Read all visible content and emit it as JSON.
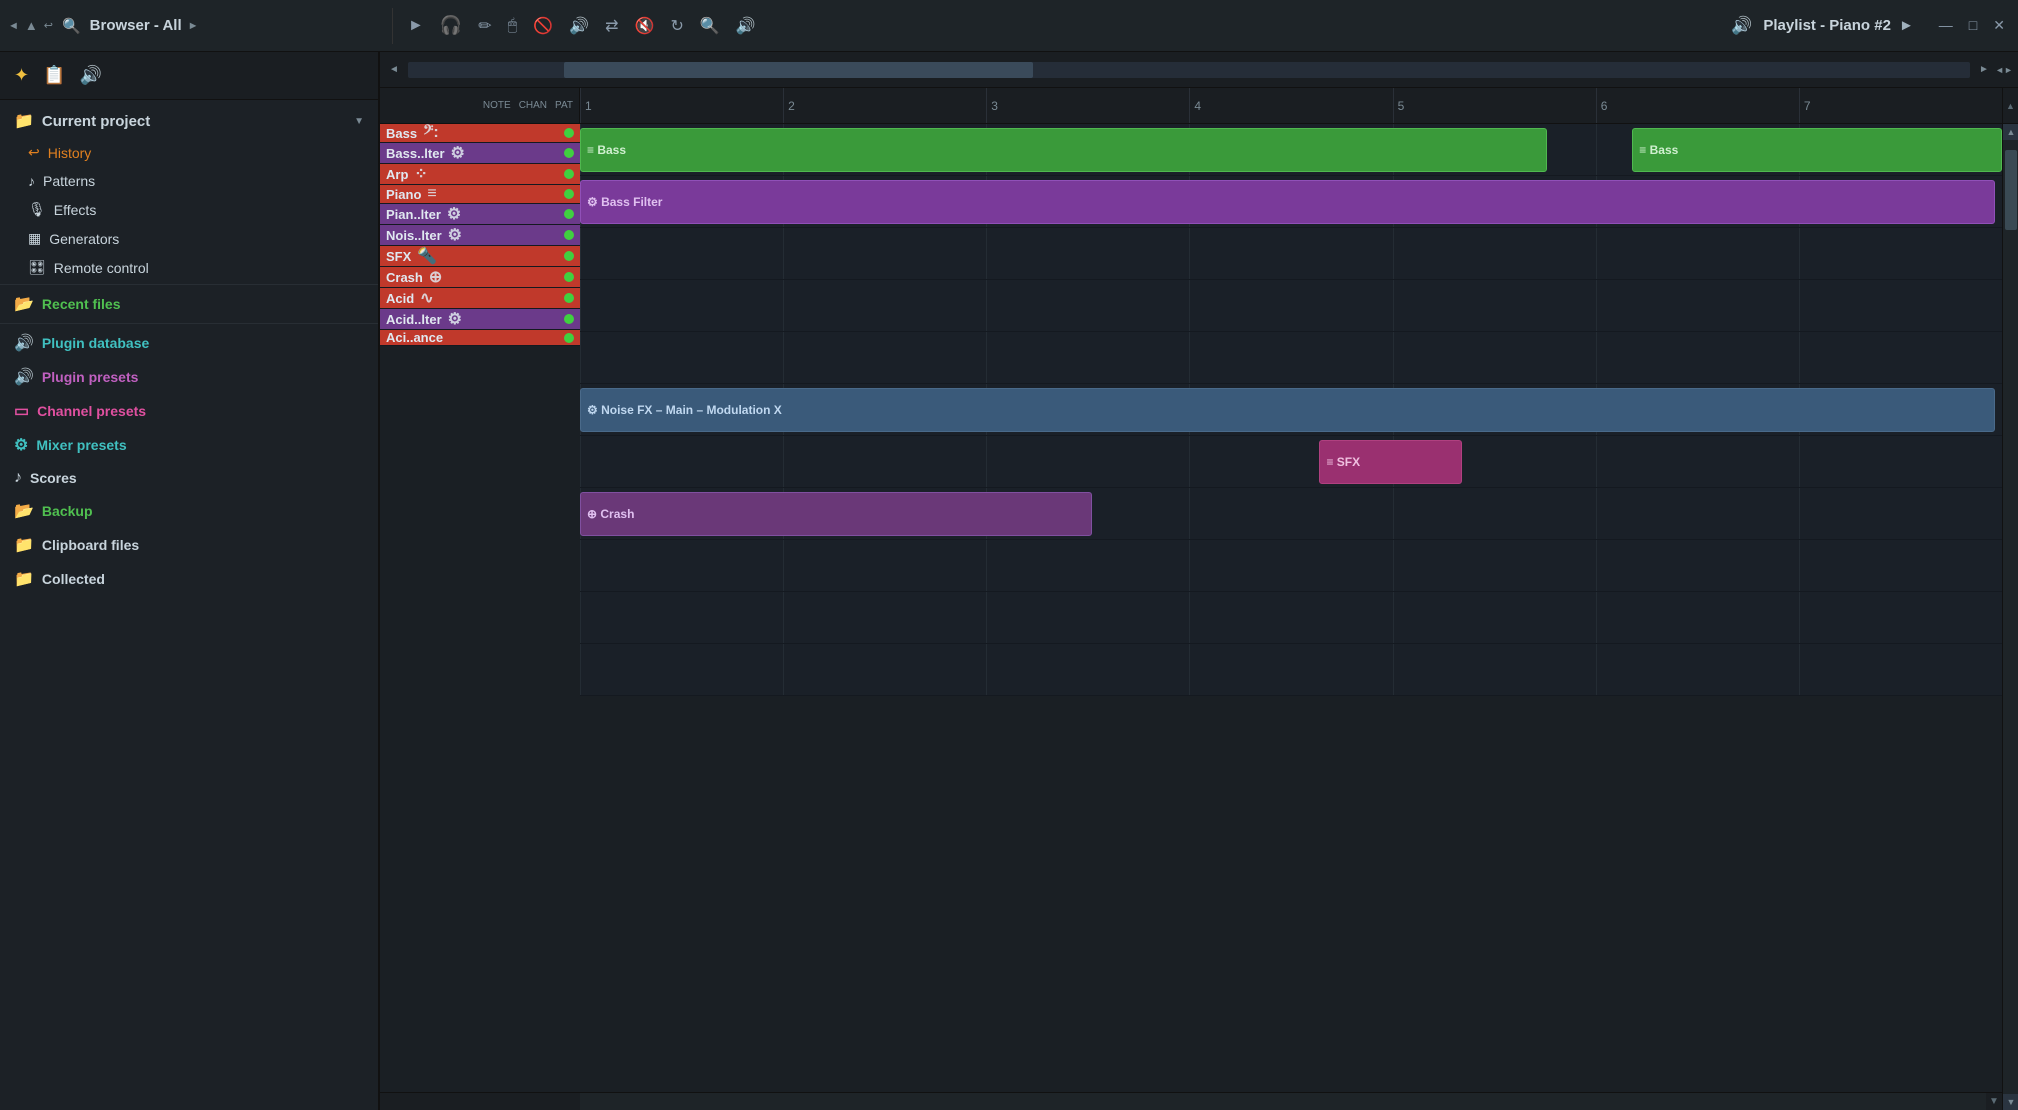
{
  "topbar": {
    "nav_prev": "◄",
    "nav_up": "▲",
    "nav_back": "↩",
    "search_icon": "🔍",
    "browser_title": "Browser - All",
    "nav_next": "►",
    "playlist_title": "Playlist - Piano #2",
    "playlist_arrow": "►",
    "win_min": "—",
    "win_max": "□",
    "win_close": "✕"
  },
  "sidebar": {
    "toolbar": {
      "star_icon": "✦",
      "file_icon": "📋",
      "speaker_icon": "🔊"
    },
    "current_project_label": "Current project",
    "items": [
      {
        "label": "History",
        "icon": "↩",
        "color": "orange"
      },
      {
        "label": "Patterns",
        "icon": "♪",
        "color": "white"
      },
      {
        "label": "Effects",
        "icon": "🎙",
        "color": "white"
      },
      {
        "label": "Generators",
        "icon": "▦",
        "color": "white"
      },
      {
        "label": "Remote control",
        "icon": "🎛",
        "color": "white"
      }
    ],
    "nav_items": [
      {
        "label": "Recent files",
        "icon": "📂",
        "color": "green"
      },
      {
        "label": "Plugin database",
        "icon": "🔊",
        "color": "cyan"
      },
      {
        "label": "Plugin presets",
        "icon": "🔊",
        "color": "purple"
      },
      {
        "label": "Channel presets",
        "icon": "▭",
        "color": "pink"
      },
      {
        "label": "Mixer presets",
        "icon": "⚙",
        "color": "cyan"
      },
      {
        "label": "Scores",
        "icon": "♪",
        "color": "white"
      },
      {
        "label": "Backup",
        "icon": "📂",
        "color": "green"
      },
      {
        "label": "Clipboard files",
        "icon": "📁",
        "color": "white"
      },
      {
        "label": "Collected",
        "icon": "📁",
        "color": "white"
      }
    ]
  },
  "playlist": {
    "ruler": [
      "1",
      "2",
      "3",
      "4",
      "5",
      "6",
      "7"
    ],
    "header_cols": [
      "NOTE",
      "CHAN",
      "PAT"
    ],
    "tracks": [
      {
        "name": "Bass",
        "icon": "𝄢",
        "color_class": "track-bass",
        "clips": [
          {
            "label": "≡ Bass",
            "start_pct": 0,
            "width_pct": 68,
            "color": "clip-green"
          },
          {
            "label": "≡ Bass",
            "start_pct": 74,
            "width_pct": 26,
            "color": "clip-green"
          }
        ]
      },
      {
        "name": "Bass..lter",
        "icon": "⚙",
        "color_class": "track-bass-filter",
        "clips": [
          {
            "label": "⚙ Bass Filter",
            "start_pct": 0,
            "width_pct": 100,
            "color": "clip-purple"
          }
        ]
      },
      {
        "name": "Arp",
        "icon": "⁘",
        "color_class": "track-arp",
        "clips": []
      },
      {
        "name": "Piano",
        "icon": "≡",
        "color_class": "track-piano",
        "clips": []
      },
      {
        "name": "Pian..lter",
        "icon": "⚙",
        "color_class": "track-piano-filter",
        "clips": []
      },
      {
        "name": "Nois..lter",
        "icon": "⚙",
        "color_class": "track-nois-filter",
        "clips": [
          {
            "label": "⚙ Noise FX – Main – Modulation X",
            "start_pct": 0,
            "width_pct": 100,
            "color": "clip-blue"
          }
        ]
      },
      {
        "name": "SFX",
        "icon": "🔦",
        "color_class": "track-sfx",
        "clips": [
          {
            "label": "≡ SFX",
            "start_pct": 52,
            "width_pct": 10,
            "color": "clip-pink"
          }
        ]
      },
      {
        "name": "Crash",
        "icon": "⊕",
        "color_class": "track-crash",
        "clips": [
          {
            "label": "⊕ Crash",
            "start_pct": 0,
            "width_pct": 36,
            "color": "clip-purple2"
          }
        ]
      },
      {
        "name": "Acid",
        "icon": "∿",
        "color_class": "track-acid",
        "clips": []
      },
      {
        "name": "Acid..lter",
        "icon": "⚙",
        "color_class": "track-acid-filter",
        "clips": []
      },
      {
        "name": "Aci..ance",
        "icon": "",
        "color_class": "track-aciance",
        "clips": []
      }
    ]
  }
}
